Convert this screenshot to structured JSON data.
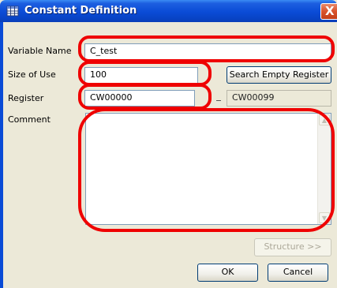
{
  "window": {
    "title": "Constant Definition",
    "close_glyph": "X",
    "title_icon": "table-grid-icon"
  },
  "form": {
    "variable_name": {
      "label": "Variable Name",
      "value": "C_test"
    },
    "size_of_use": {
      "label": "Size of Use",
      "value": "100"
    },
    "register": {
      "label": "Register",
      "value": "CW00000",
      "end_value": "CW00099"
    },
    "comment": {
      "label": "Comment",
      "value": ""
    }
  },
  "buttons": {
    "search_empty_register": "Search Empty Register",
    "structure": "Structure >>",
    "ok": "OK",
    "cancel": "Cancel"
  },
  "colors": {
    "titlebar": "#0a4bd6",
    "dialog_bg": "#ece9d8",
    "highlight": "#ef0000",
    "close_button": "#d9532c"
  }
}
